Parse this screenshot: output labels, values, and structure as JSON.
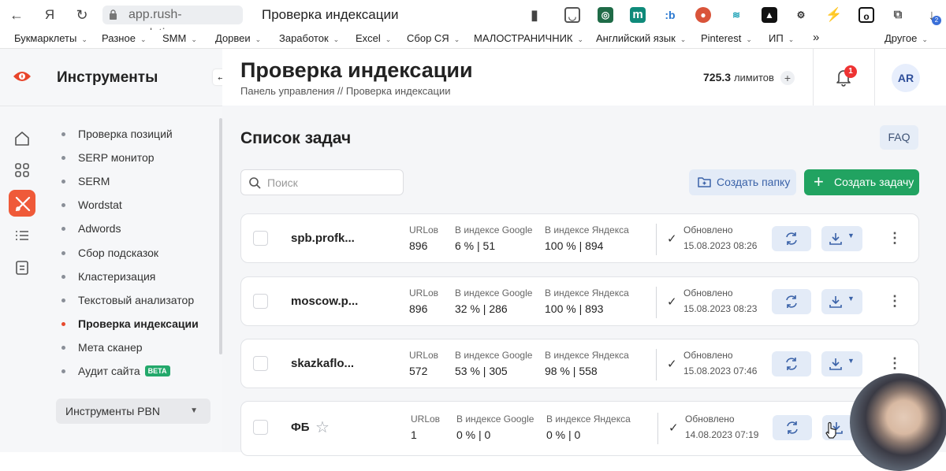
{
  "browser": {
    "url": "app.rush-analytics.ru",
    "tab_title": "Проверка индексации",
    "bookmarks": [
      "Букмарклеты",
      "Разное",
      "SMM",
      "Дорвеи",
      "Заработок",
      "Excel",
      "Сбор СЯ",
      "МАЛОСТРАНИЧНИК",
      "Английский язык",
      "Pinterest",
      "ИП"
    ],
    "more_label": "»",
    "other_label": "Другое",
    "download_badge": "2"
  },
  "sidebar": {
    "title": "Инструменты",
    "items": [
      {
        "label": "Проверка позиций"
      },
      {
        "label": "SERP монитор"
      },
      {
        "label": "SERM"
      },
      {
        "label": "Wordstat"
      },
      {
        "label": "Adwords"
      },
      {
        "label": "Сбор подсказок"
      },
      {
        "label": "Кластеризация"
      },
      {
        "label": "Текстовый анализатор"
      },
      {
        "label": "Проверка индексации",
        "active": true
      },
      {
        "label": "Мета сканер"
      },
      {
        "label": "Аудит сайта",
        "badge": "BETA"
      }
    ],
    "pbn_label": "Инструменты PBN"
  },
  "header": {
    "page_title": "Проверка индексации",
    "breadcrumb": "Панель управления  //  Проверка индексации",
    "limits_value": "725.3",
    "limits_label": "лимитов",
    "notifications_count": "1",
    "avatar_initials": "AR"
  },
  "content": {
    "section_title": "Список задач",
    "faq_label": "FAQ",
    "search_placeholder": "Поиск",
    "create_folder_label": "Создать папку",
    "create_task_label": "Создать задачу",
    "col_urls": "URLов",
    "col_google": "В индексе Google",
    "col_yandex": "В индексе Яндекса",
    "col_updated": "Обновлено",
    "tasks": [
      {
        "name": "spb.profk...",
        "urls": "896",
        "google": "6 % | 51",
        "yandex": "100 % | 894",
        "updated": "15.08.2023 08:26"
      },
      {
        "name": "moscow.p...",
        "urls": "896",
        "google": "32 % | 286",
        "yandex": "100 % | 893",
        "updated": "15.08.2023 08:23"
      },
      {
        "name": "skazkaflo...",
        "urls": "572",
        "google": "53 % | 305",
        "yandex": "98 % | 558",
        "updated": "15.08.2023 07:46"
      },
      {
        "name": "ФБ",
        "urls": "1",
        "google": "0 % | 0",
        "yandex": "0 % | 0",
        "updated": "14.08.2023 07:19",
        "starred": false
      }
    ]
  },
  "colors": {
    "accent": "#ef5a39",
    "green": "#21a361",
    "blue_soft": "#e3ebf7",
    "highlight": "#f7d449"
  }
}
